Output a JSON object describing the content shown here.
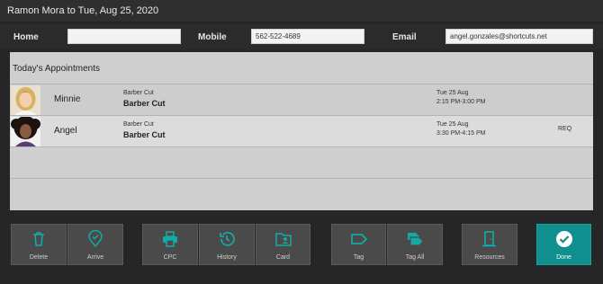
{
  "window": {
    "title": "Ramon Mora to Tue, Aug 25, 2020"
  },
  "contact": {
    "home_label": "Home",
    "home_value": "",
    "mobile_label": "Mobile",
    "mobile_value": "562-522-4689",
    "email_label": "Email",
    "email_value": "angel.gonzales@shortcuts.net"
  },
  "appointments": {
    "heading": "Today's Appointments",
    "rows": [
      {
        "name": "Minnie",
        "service_small": "Barber Cut",
        "service": "Barber Cut",
        "date": "Tue 25 Aug",
        "time": "2:15 PM-3:00 PM",
        "flag": ""
      },
      {
        "name": "Angel",
        "service_small": "Barber Cut",
        "service": "Barber Cut",
        "date": "Tue 25 Aug",
        "time": "3:30 PM-4:15 PM",
        "flag": "REQ"
      }
    ]
  },
  "toolbar": {
    "delete": "Delete",
    "arrive": "Arrive",
    "cpc": "CPC",
    "history": "History",
    "card": "Card",
    "tag": "Tag",
    "tag_all": "Tag All",
    "resources": "Resources",
    "done": "Done"
  },
  "colors": {
    "accent": "#0f8f8d",
    "icon": "#13aaa6",
    "background": "#262626",
    "panel": "#cfcfcf"
  },
  "icons": [
    "trash-icon",
    "location-check-icon",
    "printer-icon",
    "history-icon",
    "folder-user-icon",
    "tag-icon",
    "tags-icon",
    "door-icon",
    "checkmark-circle-icon"
  ]
}
